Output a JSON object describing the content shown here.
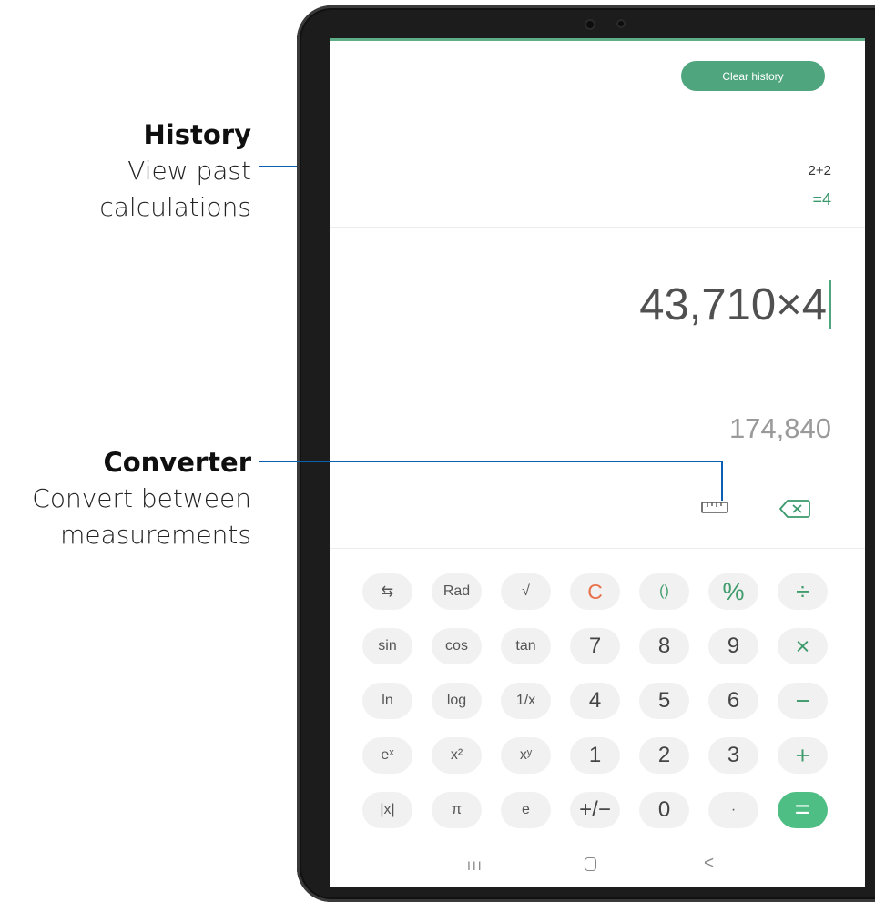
{
  "callouts": {
    "history": {
      "title": "History",
      "desc_line1": "View past",
      "desc_line2": "calculations"
    },
    "converter": {
      "title": "Converter",
      "desc_line1": "Convert between",
      "desc_line2": "measurements"
    }
  },
  "app": {
    "clear_history_label": "Clear history",
    "history": {
      "expression": "2+2",
      "result": "=4"
    },
    "expression": "43,710×4",
    "preview_result": "174,840",
    "accent_color": "#4fa57d"
  },
  "keypad": {
    "rows": [
      [
        "⇆",
        "Rad",
        "√",
        "C",
        "()",
        "%",
        "÷"
      ],
      [
        "sin",
        "cos",
        "tan",
        "7",
        "8",
        "9",
        "×"
      ],
      [
        "ln",
        "log",
        "1/x",
        "4",
        "5",
        "6",
        "−"
      ],
      [
        "eˣ",
        "x²",
        "xʸ",
        "1",
        "2",
        "3",
        "+"
      ],
      [
        "|x|",
        "π",
        "e",
        "+/−",
        "0",
        "·",
        "="
      ]
    ]
  },
  "nav": {
    "recents": "III",
    "back": "<"
  }
}
